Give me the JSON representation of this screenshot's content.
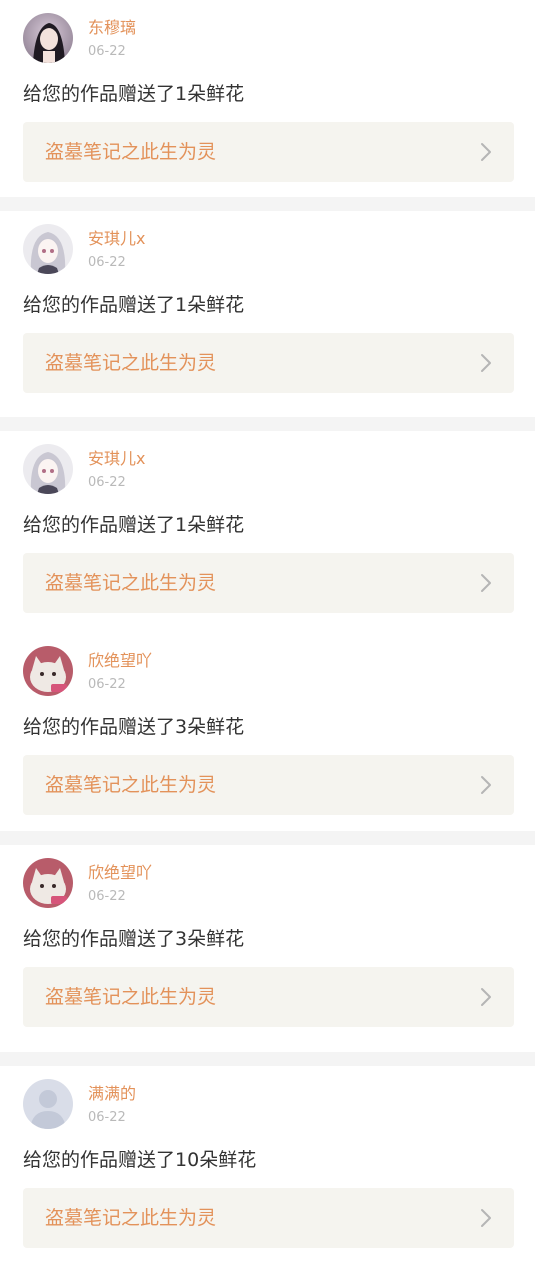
{
  "colors": {
    "accent": "#e3925a",
    "date": "#b9b9b9",
    "text": "#333333",
    "work_bg": "#f5f4ef",
    "separator": "#f4f4f4"
  },
  "icons": {
    "work_arrow": "chevron-right-icon"
  },
  "notifications": [
    {
      "user": "东穆璃",
      "date": "06-22",
      "avatar": "girl-photo-avatar",
      "message_prefix": "给您的作品赠送了",
      "count": "1",
      "message_suffix": "朵鲜花",
      "work_title": "盗墓笔记之此生为灵"
    },
    {
      "user": "安琪儿x",
      "date": "06-22",
      "avatar": "anime-girl-avatar",
      "message_prefix": "给您的作品赠送了",
      "count": "1",
      "message_suffix": "朵鲜花",
      "work_title": "盗墓笔记之此生为灵"
    },
    {
      "user": "安琪儿x",
      "date": "06-22",
      "avatar": "anime-girl-avatar",
      "message_prefix": "给您的作品赠送了",
      "count": "1",
      "message_suffix": "朵鲜花",
      "work_title": "盗墓笔记之此生为灵"
    },
    {
      "user": "欣绝望吖",
      "date": "06-22",
      "avatar": "cat-avatar",
      "message_prefix": "给您的作品赠送了",
      "count": "3",
      "message_suffix": "朵鲜花",
      "work_title": "盗墓笔记之此生为灵"
    },
    {
      "user": "欣绝望吖",
      "date": "06-22",
      "avatar": "cat-avatar",
      "message_prefix": "给您的作品赠送了",
      "count": "3",
      "message_suffix": "朵鲜花",
      "work_title": "盗墓笔记之此生为灵"
    },
    {
      "user": "满满的",
      "date": "06-22",
      "avatar": "default-avatar",
      "message_prefix": "给您的作品赠送了",
      "count": "10",
      "message_suffix": "朵鲜花",
      "work_title": "盗墓笔记之此生为灵"
    }
  ]
}
